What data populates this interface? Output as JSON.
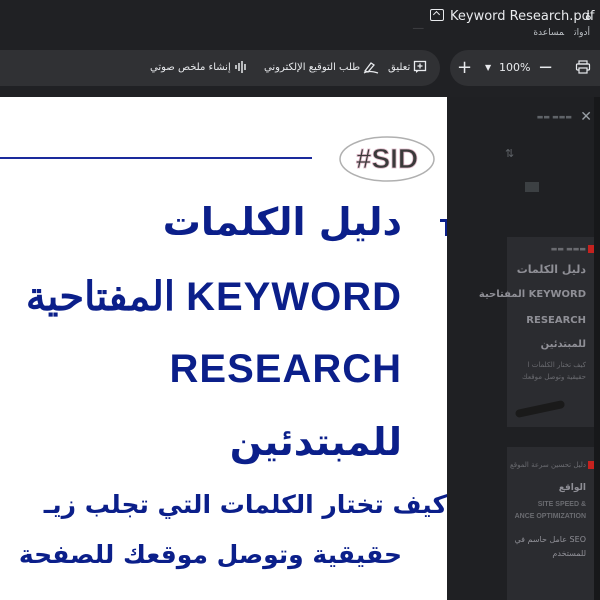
{
  "window": {
    "title": "Keyword Research.pdf",
    "title_fragment": "ة",
    "menu": [
      "أدوات",
      "مساعدة"
    ]
  },
  "toolbar": {
    "voice_summary": "إنشاء ملخص صوتي",
    "esign": "طلب التوقيع الإلكتروني",
    "comment": "تعليق",
    "zoom": "100%"
  },
  "document": {
    "title_line1": "دليل الكلمات",
    "title_line2": "المفتاحية KEYWORD",
    "title_line3": "RESEARCH",
    "title_line4": "للمبتدئين",
    "subtitle_line1": "كيف تختار الكلمات التي تجلب زيـ",
    "subtitle_line2": "حقيقية وتوصل موقعك للصفحة",
    "logo_text": "#SID"
  },
  "sidebar": {
    "thumb1": {
      "lines": [
        "دليل الكلمات",
        "المفتاحية KEYWORD",
        "RESEARCH",
        "للمبتدئين"
      ],
      "sub": [
        "كيف تختار الكلمات ا",
        "حقيقية وتوصل موقعك"
      ]
    },
    "thumb2": {
      "label": "دليل تحسين سرعة الموقع",
      "lines": [
        "الواقع",
        "SITE SPEED &",
        "ANCE OPTIMIZATION"
      ],
      "sub": [
        "عامل حاسم في SEO",
        "للمستخدم"
      ]
    }
  },
  "colors": {
    "accent": "#0b1f8a",
    "chrome": "#202124",
    "pill": "#303134"
  }
}
